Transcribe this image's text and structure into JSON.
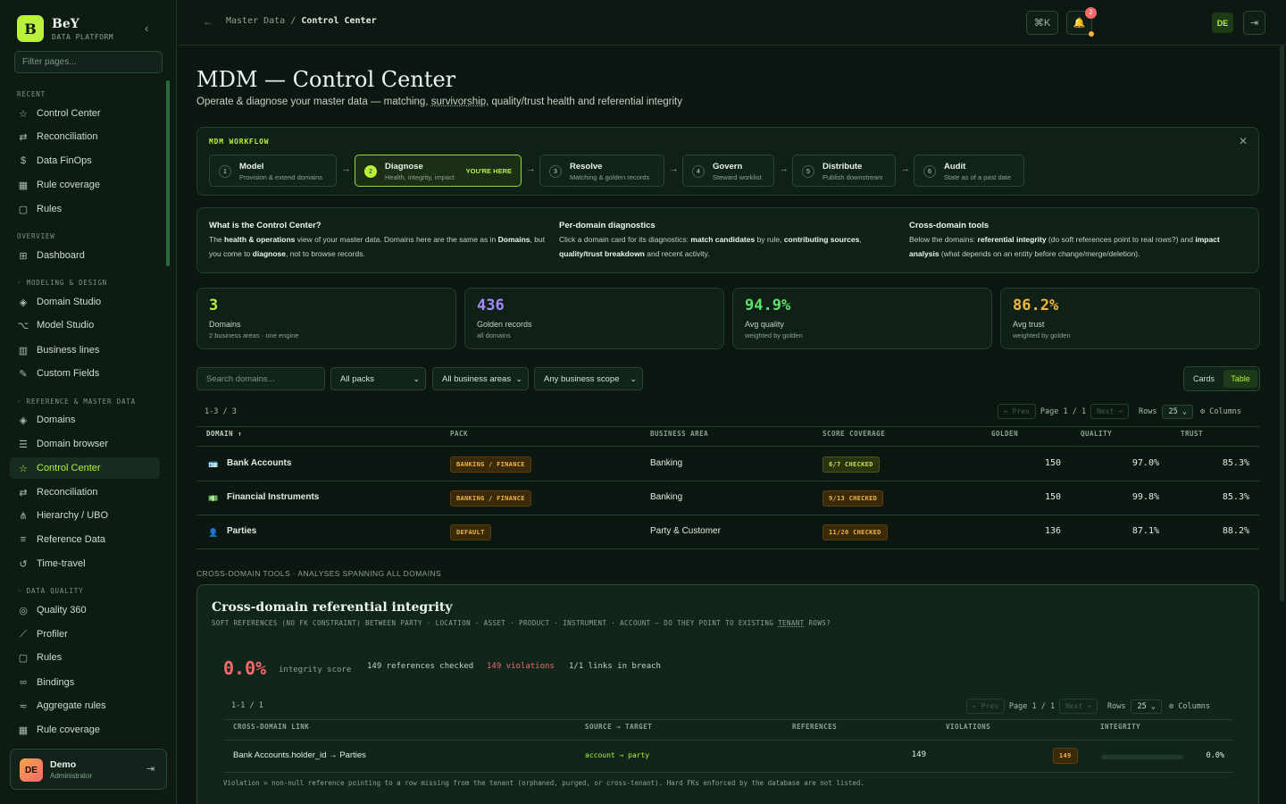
{
  "brand": {
    "logo": "B",
    "name": "BeY",
    "sub": "DATA PLATFORM"
  },
  "sidebar": {
    "filter_placeholder": "Filter pages...",
    "sections": {
      "recent": "RECENT",
      "overview": "OVERVIEW",
      "modeling": "◦ MODELING & DESIGN",
      "reference": "◦ REFERENCE & MASTER DATA",
      "quality": "◦ DATA QUALITY"
    },
    "recent": [
      "Control Center",
      "Reconciliation",
      "Data FinOps",
      "Rule coverage",
      "Rules"
    ],
    "overview": [
      "Dashboard"
    ],
    "modeling": [
      "Domain Studio",
      "Model Studio",
      "Business lines",
      "Custom Fields"
    ],
    "reference": [
      "Domains",
      "Domain browser",
      "Control Center",
      "Reconciliation",
      "Hierarchy / UBO",
      "Reference Data",
      "Time-travel"
    ],
    "quality": [
      "Quality 360",
      "Profiler",
      "Rules",
      "Bindings",
      "Aggregate rules",
      "Rule coverage"
    ],
    "user": {
      "initials": "DE",
      "name": "Demo",
      "role": "Administrator"
    }
  },
  "topbar": {
    "crumb_parent": "Master Data",
    "crumb_sep": "/",
    "crumb_current": "Control Center",
    "cmd": "⌘K",
    "notif_count": "2",
    "user_initials": "DE"
  },
  "page": {
    "title": "MDM — Control Center",
    "sub_pre": "Operate & diagnose your master data — matching, ",
    "sub_link": "survivorship",
    "sub_post": ", quality/trust health and referential integrity"
  },
  "workflow": {
    "title": "MDM WORKFLOW",
    "here_label": "YOU'RE HERE",
    "steps": [
      {
        "n": "1",
        "t": "Model",
        "d": "Provision & extend domains"
      },
      {
        "n": "2",
        "t": "Diagnose",
        "d": "Health, integrity, impact"
      },
      {
        "n": "3",
        "t": "Resolve",
        "d": "Matching & golden records"
      },
      {
        "n": "4",
        "t": "Govern",
        "d": "Steward worklist"
      },
      {
        "n": "5",
        "t": "Distribute",
        "d": "Publish downstream"
      },
      {
        "n": "6",
        "t": "Audit",
        "d": "State as of a past date"
      }
    ]
  },
  "info": {
    "c1_h": "What is the Control Center?",
    "c1_a": "The ",
    "c1_b": "health & operations",
    "c1_c": " view of your master data. Domains here are the same as in ",
    "c1_d": "Domains",
    "c1_e": ", but you come to ",
    "c1_f": "diagnose",
    "c1_g": ", not to browse records.",
    "c2_h": "Per-domain diagnostics",
    "c2_a": "Click a domain card for its diagnostics: ",
    "c2_b": "match candidates",
    "c2_c": " by rule, ",
    "c2_d": "contributing sources",
    "c2_e": ", ",
    "c2_f": "quality/trust breakdown",
    "c2_g": " and recent activity.",
    "c3_h": "Cross-domain tools",
    "c3_a": "Below the domains: ",
    "c3_b": "referential integrity",
    "c3_c": " (do soft references point to real rows?) and ",
    "c3_d": "impact analysis",
    "c3_e": " (what depends on an entity before change/merge/deletion)."
  },
  "kpis": [
    {
      "v": "3",
      "l": "Domains",
      "s": "2 business areas · one engine",
      "color": "#b9f13c"
    },
    {
      "v": "436",
      "l": "Golden records",
      "s": "all domains",
      "color": "#a78bfa"
    },
    {
      "v": "94.9%",
      "l": "Avg quality",
      "s": "weighted by golden",
      "color": "#5ee06b"
    },
    {
      "v": "86.2%",
      "l": "Avg trust",
      "s": "weighted by golden",
      "color": "#f2b53c"
    }
  ],
  "filters": {
    "search_placeholder": "Search domains...",
    "packs": "All packs",
    "areas": "All business areas",
    "scope": "Any business scope",
    "cards": "Cards",
    "table": "Table"
  },
  "pager": {
    "count": "1-3 / 3",
    "prev": "← Prev",
    "page": "Page 1 / 1",
    "next": "Next →",
    "rows_label": "Rows",
    "rows": "25",
    "columns": "⚙ Columns"
  },
  "domains": {
    "headers": [
      "DOMAIN ↑",
      "PACK",
      "BUSINESS AREA",
      "SCORE COVERAGE",
      "GOLDEN",
      "QUALITY",
      "TRUST"
    ],
    "rows": [
      {
        "flag": "🪪",
        "name": "Bank Accounts",
        "pack": "BANKING / FINANCE",
        "area": "Banking",
        "cov": "6/7 CHECKED",
        "golden": "150",
        "quality": "97.0%",
        "trust": "85.3%"
      },
      {
        "flag": "💵",
        "name": "Financial Instruments",
        "pack": "BANKING / FINANCE",
        "area": "Banking",
        "cov": "9/13 CHECKED",
        "golden": "150",
        "quality": "99.8%",
        "trust": "85.3%"
      },
      {
        "flag": "👤",
        "name": "Parties",
        "pack": "DEFAULT",
        "area": "Party & Customer",
        "cov": "11/20 CHECKED",
        "golden": "136",
        "quality": "87.1%",
        "trust": "88.2%"
      }
    ]
  },
  "cross": {
    "section": "CROSS-DOMAIN TOOLS · ANALYSES SPANNING ALL DOMAINS",
    "title": "Cross-domain referential integrity",
    "sub_pre": "SOFT REFERENCES (NO FK CONSTRAINT) BETWEEN PARTY · LOCATION · ASSET · PRODUCT · INSTRUMENT · ACCOUNT — DO THEY POINT TO EXISTING ",
    "sub_link": "TENANT",
    "sub_post": " ROWS?",
    "score": "0.0%",
    "score_label": "integrity score",
    "checked": "149 references checked",
    "violations": "149 violations",
    "breach": "1/1 links in breach",
    "pager": {
      "count": "1-1 / 1",
      "prev": "← Prev",
      "page": "Page 1 / 1",
      "next": "Next →",
      "rows_label": "Rows",
      "rows": "25",
      "columns": "⚙ Columns"
    },
    "headers": [
      "CROSS-DOMAIN LINK",
      "SOURCE → TARGET",
      "REFERENCES",
      "VIOLATIONS",
      "INTEGRITY"
    ],
    "row": {
      "link": "Bank Accounts.holder_id → Parties",
      "st": "account → party",
      "refs": "149",
      "viol": "149",
      "integrity": "0.0%"
    },
    "footnote": "Violation = non-null reference pointing to a row missing from the tenant (orphaned, purged, or cross-tenant). Hard FKs enforced by the database are not listed."
  }
}
